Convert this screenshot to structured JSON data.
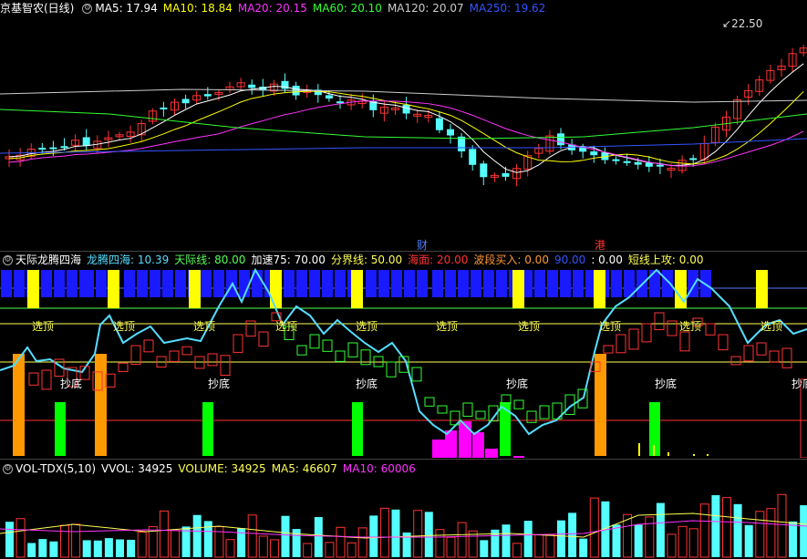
{
  "main": {
    "title": "京基智农(日线)",
    "ma": [
      {
        "label": "MA5: 17.94",
        "color": "#ffffff"
      },
      {
        "label": "MA10: 18.84",
        "color": "#ffff00"
      },
      {
        "label": "MA20: 20.15",
        "color": "#ff33ff"
      },
      {
        "label": "MA60: 20.10",
        "color": "#33ff33"
      },
      {
        "label": "MA120: 20.07",
        "color": "#cccccc"
      },
      {
        "label": "MA250: 19.62",
        "color": "#3355ff"
      }
    ],
    "high_label": "22.50",
    "event_markers": [
      {
        "text": "财",
        "color": "#4f7bff"
      },
      {
        "text": "港",
        "color": "#ff3333"
      }
    ]
  },
  "indicator": {
    "name": "天际龙腾四海",
    "values": [
      {
        "label": "龙腾四海: 10.39",
        "color": "#55ddff"
      },
      {
        "label": "天际线: 80.00",
        "color": "#55ff55"
      },
      {
        "label": "加速75: 70.00",
        "color": "#ffffff"
      },
      {
        "label": "分界线: 50.00",
        "color": "#ffff55"
      },
      {
        "label": "海面: 20.00",
        "color": "#ff3333"
      },
      {
        "label": "波段买入: 0.00",
        "color": "#ff9933"
      },
      {
        "label": "90.00",
        "color": "#3355ff"
      },
      {
        "label": ": 0.00",
        "color": "#ffffff"
      },
      {
        "label": "短线上攻: 0.00",
        "color": "#ffff55"
      }
    ],
    "select_label": "选顶",
    "bottom_label": "抄底"
  },
  "volume": {
    "name": "VOL-TDX(5,10)",
    "values": [
      {
        "label": "VVOL: 34925",
        "color": "#ffffff"
      },
      {
        "label": "VOLUME: 34925",
        "color": "#ffff55"
      },
      {
        "label": "MA5: 46607",
        "color": "#ffff55"
      },
      {
        "label": "MA10: 60006",
        "color": "#ff33ff"
      }
    ]
  },
  "colors": {
    "up": "#ff3333",
    "down": "#55ffff",
    "ma5": "#ffffff",
    "ma10": "#ffff00",
    "ma20": "#ff33ff",
    "ma60": "#33ff33",
    "ma120": "#cccccc",
    "ma250": "#3355ff"
  }
}
